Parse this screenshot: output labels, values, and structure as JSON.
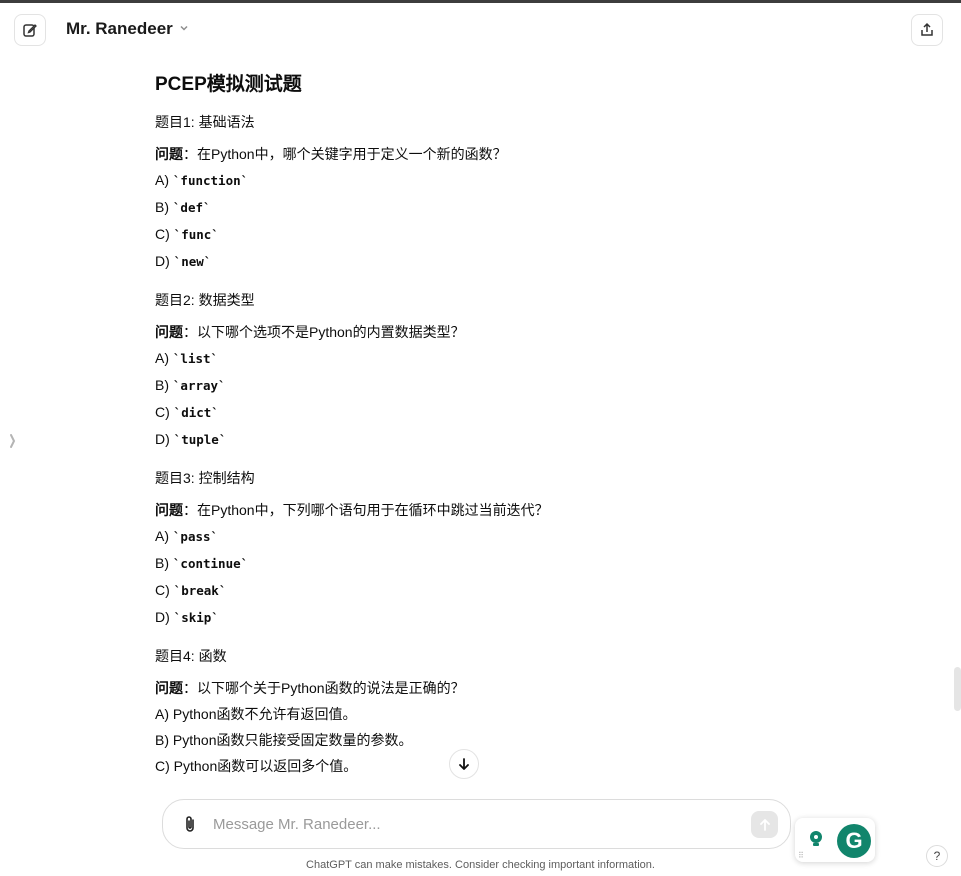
{
  "header": {
    "model_name": "Mr. Ranedeer"
  },
  "document": {
    "title": "PCEP模拟测试题",
    "questions": [
      {
        "heading": "题目1: 基础语法",
        "label": "问题",
        "text": "：在Python中，哪个关键字用于定义一个新的函数？",
        "options": [
          {
            "prefix": "A) ",
            "code": "`function`"
          },
          {
            "prefix": "B) ",
            "code": "`def`"
          },
          {
            "prefix": "C) ",
            "code": "`func`"
          },
          {
            "prefix": "D) ",
            "code": "`new`"
          }
        ]
      },
      {
        "heading": "题目2: 数据类型",
        "label": "问题",
        "text": "：以下哪个选项不是Python的内置数据类型？",
        "options": [
          {
            "prefix": "A) ",
            "code": "`list`"
          },
          {
            "prefix": "B) ",
            "code": "`array`"
          },
          {
            "prefix": "C) ",
            "code": "`dict`"
          },
          {
            "prefix": "D) ",
            "code": "`tuple`"
          }
        ]
      },
      {
        "heading": "题目3: 控制结构",
        "label": "问题",
        "text": "：在Python中，下列哪个语句用于在循环中跳过当前迭代？",
        "options": [
          {
            "prefix": "A) ",
            "code": "`pass`"
          },
          {
            "prefix": "B) ",
            "code": "`continue`"
          },
          {
            "prefix": "C) ",
            "code": "`break`"
          },
          {
            "prefix": "D) ",
            "code": "`skip`"
          }
        ]
      },
      {
        "heading": "题目4: 函数",
        "label": "问题",
        "text": "：以下哪个关于Python函数的说法是正确的？",
        "options": [
          {
            "prefix": "A) ",
            "text": "Python函数不允许有返回值。"
          },
          {
            "prefix": "B) ",
            "text": "Python函数只能接受固定数量的参数。"
          },
          {
            "prefix": "C) ",
            "text": "Python函数可以返回多个值。"
          }
        ]
      }
    ]
  },
  "composer": {
    "placeholder": "Message Mr. Ranedeer..."
  },
  "footer": {
    "disclaimer": "ChatGPT can make mistakes. Consider checking important information."
  },
  "grammarly": {
    "logo_letter": "G"
  },
  "help": {
    "label": "?"
  },
  "icons": {
    "new_chat": "edit-icon",
    "share": "share-icon",
    "chevron": "chevron-down-icon",
    "attach": "paperclip-icon",
    "send": "arrow-up-icon",
    "scroll_down": "arrow-down-icon",
    "sidebar": "sidebar-toggle-icon"
  },
  "colors": {
    "grammarly_green": "#11856c",
    "send_disabled": "#e6e6e6"
  }
}
